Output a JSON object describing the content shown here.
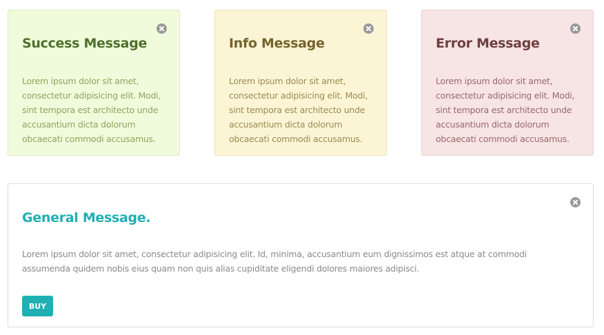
{
  "cards": [
    {
      "title": "Success Message",
      "body": "Lorem ipsum dolor sit amet, consectetur adipisicing elit. Modi, sint tempora est architecto unde accusantium dicta dolorum obcaecati commodi accusamus.",
      "close_icon": "close-circle-icon",
      "colors": {
        "background": "#f0fbdc",
        "title": "#4f6f2c",
        "body": "#8ca65d"
      }
    },
    {
      "title": "Info Message",
      "body": "Lorem ipsum dolor sit amet, consectetur adipisicing elit. Modi, sint tempora est architecto unde accusantium dicta dolorum obcaecati commodi accusamus.",
      "close_icon": "close-circle-icon",
      "colors": {
        "background": "#fbf5d6",
        "title": "#74632b",
        "body": "#9c8a52"
      }
    },
    {
      "title": "Error Message",
      "body": "Lorem ipsum dolor sit amet, consectetur adipisicing elit. Modi, sint tempora est architecto unde accusantium dicta dolorum obcaecati commodi accusamus.",
      "close_icon": "close-circle-icon",
      "colors": {
        "background": "#f7e4e4",
        "title": "#6e3e3e",
        "body": "#9a6a6a"
      }
    }
  ],
  "general": {
    "title": "General Message.",
    "body": "Lorem ipsum dolor sit amet, consectetur adipisicing elit. Id, minima, accusantium eum dignissimos est atque at commodi assumenda quidem nobis eius quam non quis alias cupiditate eligendi dolores maiores adipisci.",
    "button_label": "BUY",
    "close_icon": "close-circle-icon",
    "colors": {
      "accent": "#1fb0b3",
      "body": "#8a8a8a"
    }
  }
}
